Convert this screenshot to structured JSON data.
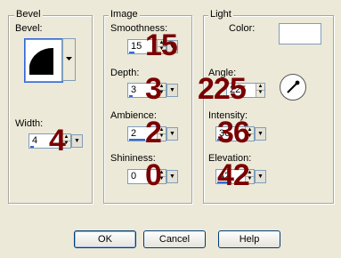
{
  "bevel": {
    "group_title": "Bevel",
    "bevel_label": "Bevel:",
    "width_label": "Width:",
    "width_value": "4",
    "width_overlay": "4",
    "width_fill": 0.1
  },
  "image": {
    "group_title": "Image",
    "smoothness_label": "Smoothness:",
    "smoothness_value": "15",
    "smoothness_overlay": "15",
    "smoothness_fill": 0.15,
    "depth_label": "Depth:",
    "depth_value": "3",
    "depth_overlay": "3",
    "depth_fill": 0.1,
    "ambience_label": "Ambience:",
    "ambience_value": "2",
    "ambience_overlay": "2",
    "ambience_fill": 0.52,
    "shininess_label": "Shininess:",
    "shininess_value": "0",
    "shininess_overlay": "0",
    "shininess_fill": 0.0
  },
  "light": {
    "group_title": "Light",
    "color_label": "Color:",
    "color_value": "#ffffff",
    "angle_label": "Angle:",
    "angle_value": "225",
    "angle_overlay": "225",
    "intensity_label": "Intensity:",
    "intensity_value": "36",
    "intensity_overlay": "36",
    "intensity_fill": 0.36,
    "elevation_label": "Elevation:",
    "elevation_value": "42",
    "elevation_overlay": "42",
    "elevation_fill": 0.47
  },
  "buttons": {
    "ok": "OK",
    "cancel": "Cancel",
    "help": "Help"
  },
  "colors": {
    "overlay_text": "#7a0000",
    "slider_fill": "#3168d5",
    "dialog_bg": "#ece9d8"
  }
}
